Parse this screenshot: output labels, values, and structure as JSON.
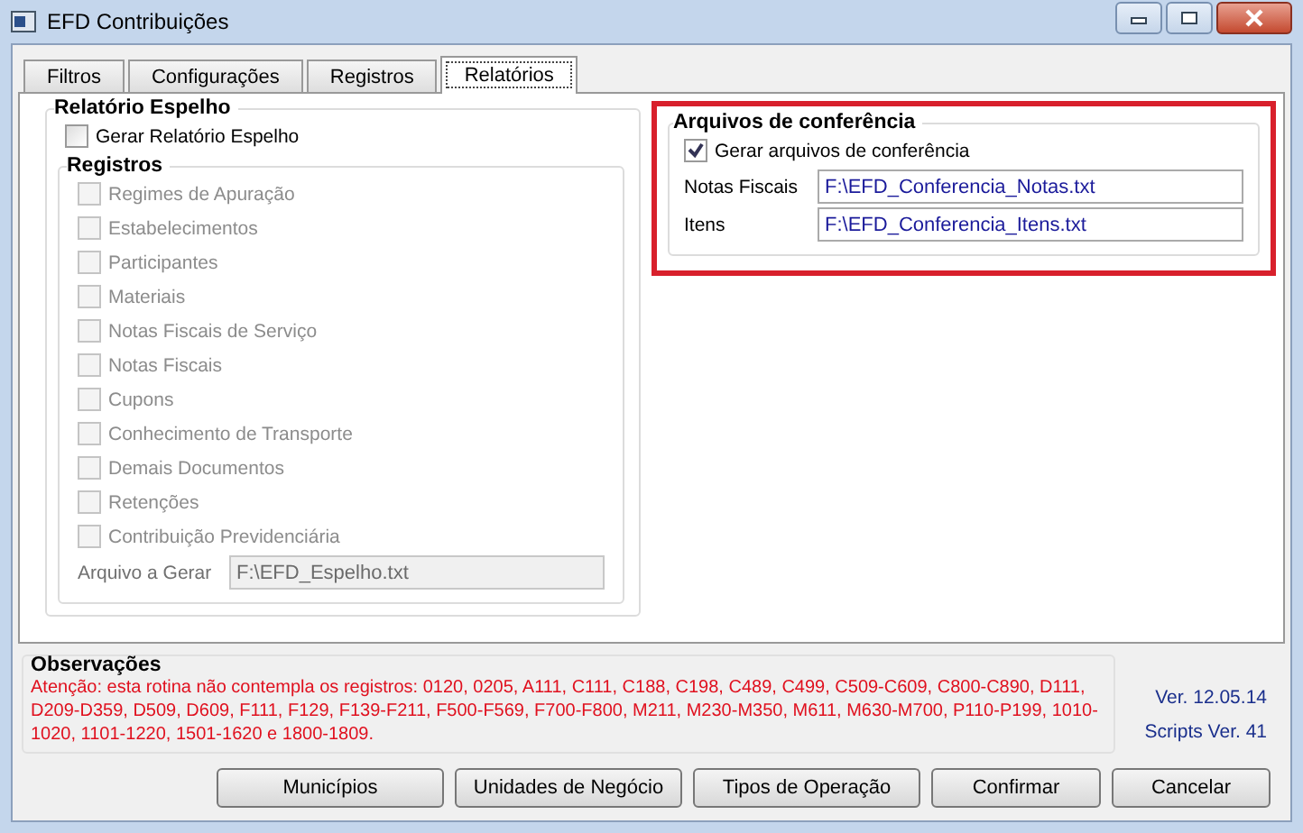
{
  "window": {
    "title": "EFD Contribuições"
  },
  "tabs": [
    {
      "label": "Filtros",
      "selected": false
    },
    {
      "label": "Configurações",
      "selected": false
    },
    {
      "label": "Registros",
      "selected": false
    },
    {
      "label": "Relatórios",
      "selected": true
    }
  ],
  "espelho": {
    "title": "Relatório Espelho",
    "checkbox": {
      "label": "Gerar Relatório Espelho",
      "checked": false
    },
    "registros": {
      "title": "Registros",
      "items": [
        {
          "label": "Regimes de Apuração",
          "checked": false,
          "disabled": true
        },
        {
          "label": "Estabelecimentos",
          "checked": false,
          "disabled": true
        },
        {
          "label": "Participantes",
          "checked": false,
          "disabled": true
        },
        {
          "label": "Materiais",
          "checked": false,
          "disabled": true
        },
        {
          "label": "Notas Fiscais de Serviço",
          "checked": false,
          "disabled": true
        },
        {
          "label": "Notas Fiscais",
          "checked": false,
          "disabled": true
        },
        {
          "label": "Cupons",
          "checked": false,
          "disabled": true
        },
        {
          "label": "Conhecimento de Transporte",
          "checked": false,
          "disabled": true
        },
        {
          "label": "Demais Documentos",
          "checked": false,
          "disabled": true
        },
        {
          "label": "Retenções",
          "checked": false,
          "disabled": true
        },
        {
          "label": "Contribuição Previdenciária",
          "checked": false,
          "disabled": true
        }
      ],
      "file": {
        "label": "Arquivo a Gerar",
        "value": "F:\\EFD_Espelho.txt",
        "disabled": true
      }
    }
  },
  "conferencia": {
    "title": "Arquivos de conferência",
    "highlighted": true,
    "checkbox": {
      "label": "Gerar arquivos de conferência",
      "checked": true
    },
    "fields": [
      {
        "label": "Notas Fiscais",
        "value": "F:\\EFD_Conferencia_Notas.txt"
      },
      {
        "label": "Itens",
        "value": "F:\\EFD_Conferencia_Itens.txt"
      }
    ]
  },
  "observacoes": {
    "title": "Observações",
    "text": "Atenção: esta rotina não contempla os registros: 0120, 0205, A111, C111, C188, C198, C489, C499, C509-C609, C800-C890, D111, D209-D359, D509, D609, F111, F129, F139-F211, F500-F569, F700-F800, M211, M230-M350, M611, M630-M700, P110-P199, 1010-1020, 1101-1220, 1501-1620 e 1800-1809."
  },
  "version": "Ver. 12.05.14",
  "scripts_version": "Scripts Ver. 41",
  "buttons": [
    "Municípios",
    "Unidades de Negócio",
    "Tipos de Operação",
    "Confirmar",
    "Cancelar"
  ]
}
